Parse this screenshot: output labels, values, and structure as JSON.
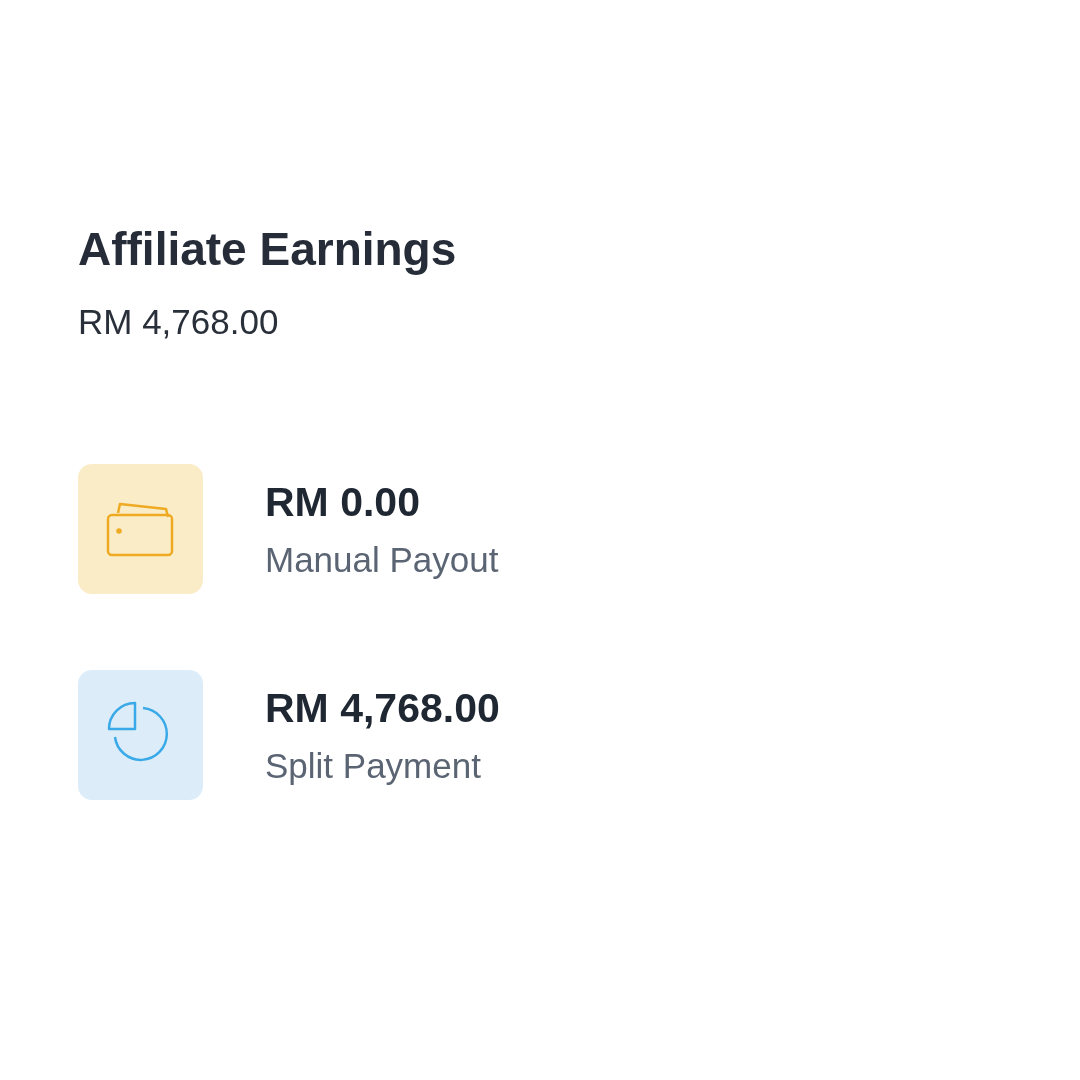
{
  "header": {
    "title": "Affiliate Earnings",
    "total": "RM 4,768.00"
  },
  "items": [
    {
      "kind": "wallet",
      "amount": "RM 0.00",
      "label": "Manual Payout"
    },
    {
      "kind": "pie",
      "amount": "RM 4,768.00",
      "label": "Split Payment"
    }
  ]
}
